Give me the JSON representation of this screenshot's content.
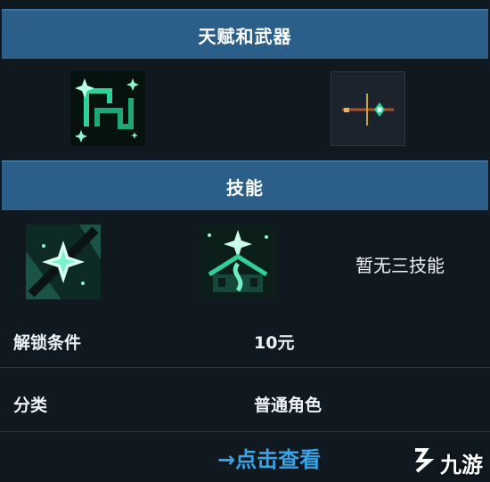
{
  "talent_weapon": {
    "header": "天赋和武器",
    "talent_icon": "talent-rune-icon",
    "weapon_icon": "staff-weapon-icon"
  },
  "skills": {
    "header": "技能",
    "skill1_icon": "star-slash-skill-icon",
    "skill2_icon": "tree-spirit-skill-icon",
    "third_skill_text": "暂无三技能"
  },
  "info": {
    "rows": [
      {
        "label": "解锁条件",
        "value": "10元"
      },
      {
        "label": "分类",
        "value": "普通角色"
      }
    ]
  },
  "link": {
    "text": "→点击查看"
  },
  "watermark": {
    "text": "九游"
  },
  "colors": {
    "header_bg": "#2b5f8a",
    "page_bg": "#101820",
    "accent_green": "#2fd19a",
    "link_blue": "#3aa3e6"
  }
}
